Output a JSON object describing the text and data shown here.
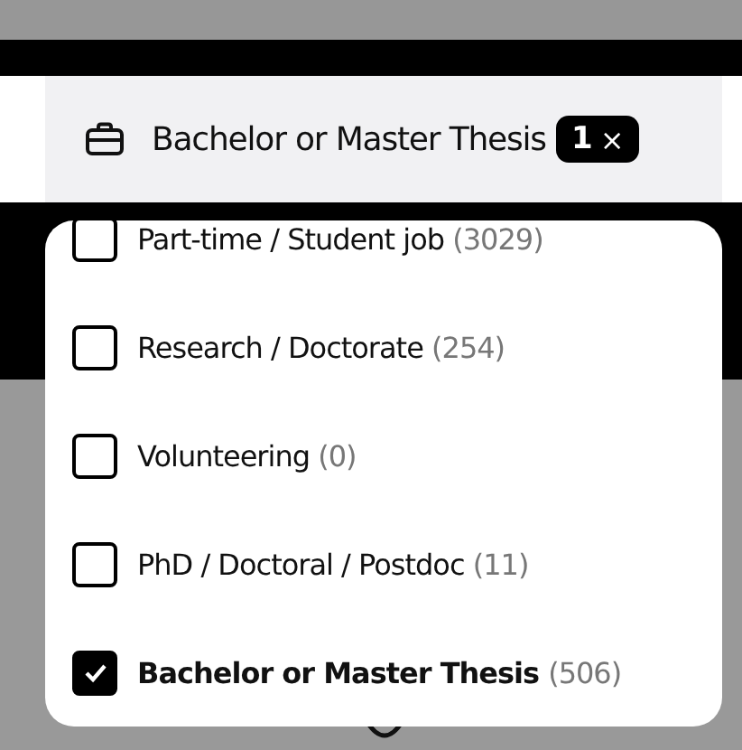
{
  "filter": {
    "label": "Bachelor or Master Thesis",
    "count": "1",
    "clear": "×"
  },
  "options": [
    {
      "label": "Part-time / Student job",
      "count": "(3029)",
      "checked": false
    },
    {
      "label": "Research / Doctorate",
      "count": "(254)",
      "checked": false
    },
    {
      "label": "Volunteering",
      "count": "(0)",
      "checked": false
    },
    {
      "label": "PhD / Doctoral / Postdoc",
      "count": "(11)",
      "checked": false
    },
    {
      "label": "Bachelor or Master Thesis",
      "count": "(506)",
      "checked": true
    }
  ]
}
